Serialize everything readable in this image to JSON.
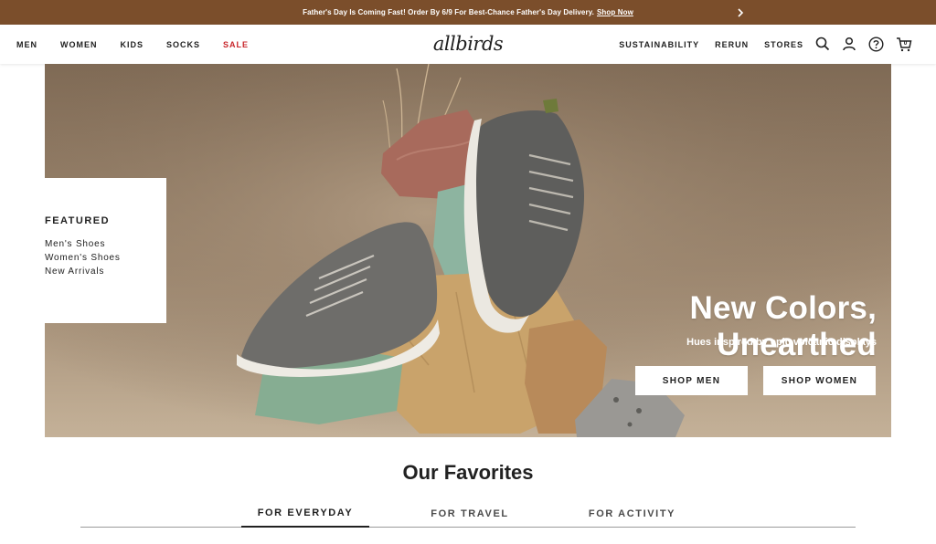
{
  "promo": {
    "message": "Father's Day Is Coming Fast! Order By 6/9 For Best-Chance Father's Day Delivery.",
    "link": "Shop Now",
    "next_icon": "chevron-right-icon"
  },
  "header": {
    "logo": "allbirds",
    "left_nav": [
      "MEN",
      "WOMEN",
      "KIDS",
      "SOCKS",
      "SALE"
    ],
    "right_nav": [
      "SUSTAINABILITY",
      "RERUN",
      "STORES"
    ],
    "icons": [
      "search-icon",
      "account-icon",
      "help-icon",
      "cart-icon"
    ],
    "cart_count": "0",
    "sale_color": "#c8262b"
  },
  "hero": {
    "featured": {
      "title": "FEATURED",
      "links": [
        "Men's Shoes",
        "Women's Shoes",
        "New Arrivals"
      ]
    },
    "headline": "New Colors, Unearthed",
    "subheadline": "Hues inspired by epic volcanic displays",
    "buttons": [
      "SHOP MEN",
      "SHOP WOMEN"
    ]
  },
  "favorites": {
    "title": "Our Favorites",
    "tabs": [
      "FOR EVERYDAY",
      "FOR TRAVEL",
      "FOR ACTIVITY"
    ],
    "active_tab": "FOR EVERYDAY"
  },
  "colors": {
    "promo_bg": "#7b4e2b",
    "accent_text": "#212121"
  }
}
